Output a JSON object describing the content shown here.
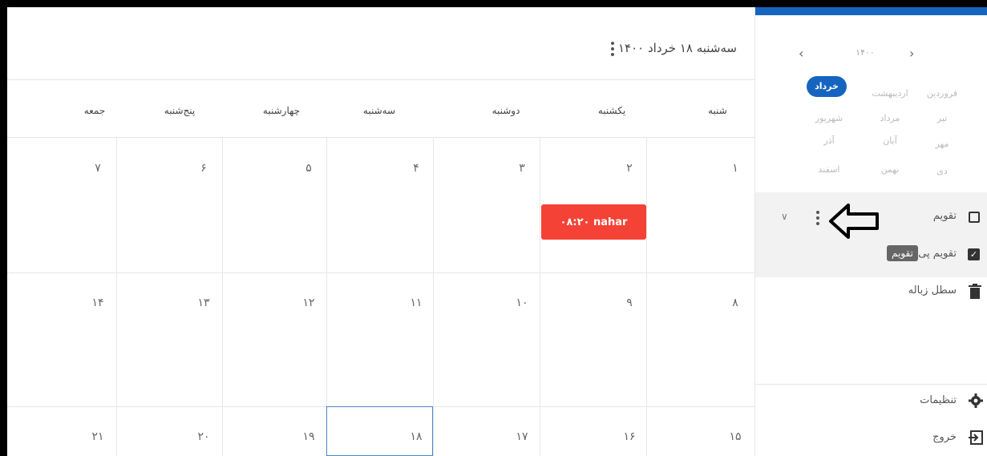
{
  "header": {
    "date_title": "سه‌شنبه ۱۸ خرداد ۱۴۰۰"
  },
  "weekdays": [
    "شنبه",
    "یکشنبه",
    "دوشنبه",
    "سه‌شنبه",
    "چهارشنبه",
    "پنج‌شنبه",
    "جمعه"
  ],
  "weeks": [
    [
      "۱",
      "۲",
      "۳",
      "۴",
      "۵",
      "۶",
      "۷"
    ],
    [
      "۸",
      "۹",
      "۱۰",
      "۱۱",
      "۱۲",
      "۱۳",
      "۱۴"
    ],
    [
      "۱۵",
      "۱۶",
      "۱۷",
      "۱۸",
      "۱۹",
      "۲۰",
      "۲۱"
    ]
  ],
  "event": {
    "label": "۰۸:۲۰ nahar",
    "color": "#f44336"
  },
  "sidebar": {
    "year": "۱۴۰۰",
    "prev_icon": "chevron-left-icon",
    "next_icon": "chevron-right-icon",
    "months": [
      [
        "فروردین",
        "اردیبهشت",
        "خرداد"
      ],
      [
        "تیر",
        "مرداد",
        "شهریور"
      ],
      [
        "مهر",
        "آبان",
        "آذر"
      ],
      [
        "دی",
        "بهمن",
        "اسفند"
      ]
    ],
    "active_month": "خرداد",
    "calendar_label": "تقویم",
    "personal_calendar_label": "تقویم پی",
    "tooltip": "تقویم",
    "trash_label": "سطل زباله",
    "settings_label": "تنظیمات",
    "logout_label": "خروج",
    "accent": "#1565c0"
  }
}
